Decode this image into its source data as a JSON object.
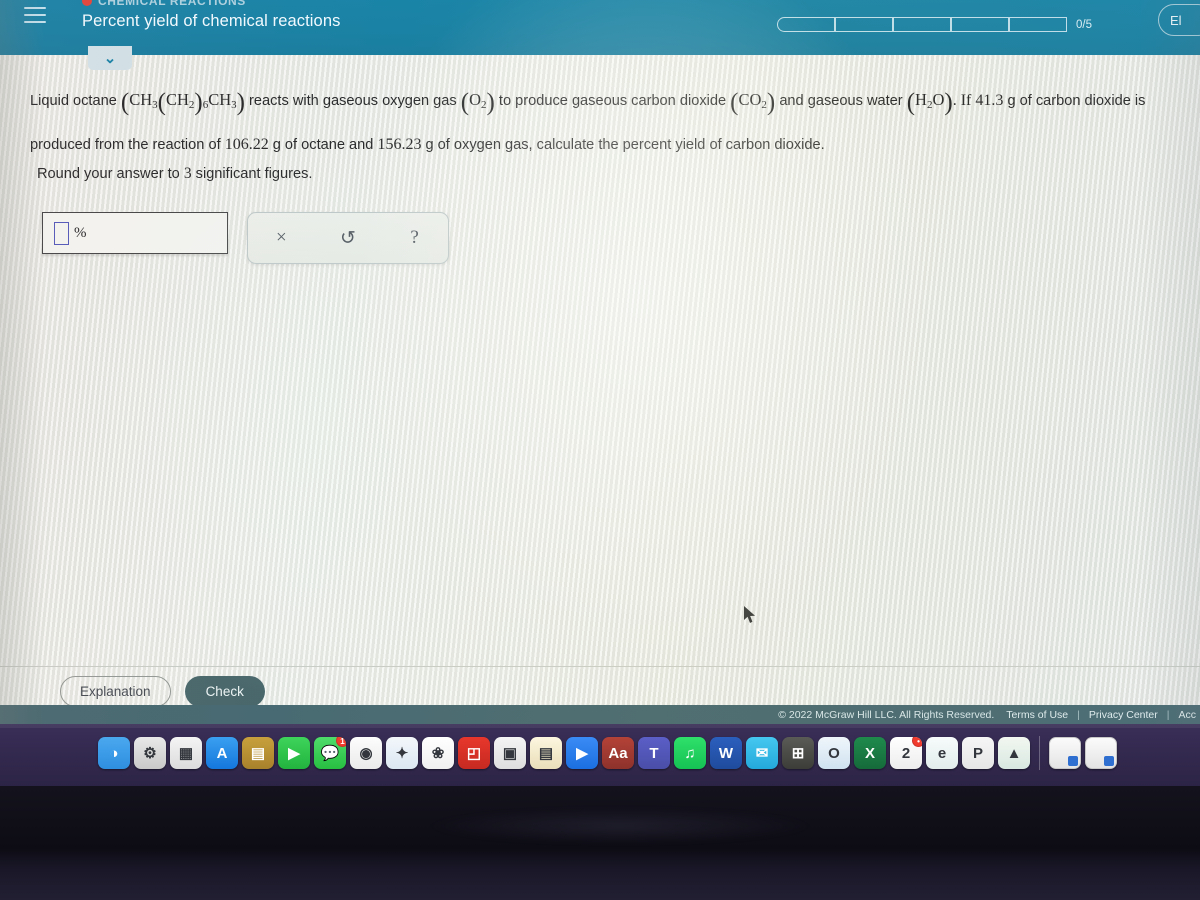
{
  "header": {
    "menu_icon": "hamburger-icon",
    "eyebrow": "CHEMICAL REACTIONS",
    "title": "Percent yield of chemical reactions",
    "progress_label": "0/5",
    "progress_segments": 5,
    "progress_filled": 0,
    "account_label": "El",
    "teal": "#0a7ba0"
  },
  "tab": {
    "chevron": "⌄"
  },
  "problem": {
    "p1": "Liquid octane",
    "f1_open": "(",
    "f1_a": "CH",
    "f1_a_sub": "3",
    "f1_b_open": "(",
    "f1_b": "CH",
    "f1_b_sub": "2",
    "f1_b_close": ")",
    "f1_b_n": "6",
    "f1_c": "CH",
    "f1_c_sub": "3",
    "f1_close": ")",
    "p2": "reacts with gaseous oxygen gas",
    "f2_open": "(",
    "f2_a": "O",
    "f2_a_sub": "2",
    "f2_close": ")",
    "p3": "to produce gaseous carbon dioxide",
    "f3_open": "(",
    "f3_a": "CO",
    "f3_a_sub": "2",
    "f3_close": ")",
    "p4": "and gaseous water",
    "f4_open": "(",
    "f4_a": "H",
    "f4_a_sub": "2",
    "f4_b": "O",
    "f4_close": ")",
    "p5": ". If",
    "mass_product": "41.3",
    "p6": "g of carbon dioxide is produced from the reaction of",
    "mass_octane": "106.22",
    "p7": "g of octane and",
    "mass_oxygen": "156.23",
    "p8": "g of oxygen gas, calculate the percent yield of carbon dioxide.",
    "round_pre": "Round your answer to",
    "round_sigfigs": "3",
    "round_post": "significant figures."
  },
  "answer": {
    "value": "",
    "placeholder": "",
    "unit": "%"
  },
  "mini_toolbar": {
    "clear": "×",
    "clear_name": "clear-icon",
    "undo": "↺",
    "undo_name": "undo-icon",
    "help": "?",
    "help_name": "help-icon"
  },
  "buttons": {
    "explanation": "Explanation",
    "check": "Check",
    "check_color": "#3e5d60"
  },
  "footer": {
    "copyright": "© 2022 McGraw Hill LLC. All Rights Reserved.",
    "links": [
      "Terms of Use",
      "Privacy Center",
      "Acc"
    ],
    "separator": "|"
  },
  "dock": {
    "items": [
      {
        "name": "finder",
        "glyph": "◑",
        "bg": "linear-gradient(180deg,#4aa8ef,#2f8fe0)",
        "running": true,
        "badge": ""
      },
      {
        "name": "system-preferences",
        "glyph": "⚙",
        "bg": "linear-gradient(180deg,#e9e9e9,#c9c9c9)",
        "running": false,
        "badge": ""
      },
      {
        "name": "launchpad",
        "glyph": "▦",
        "bg": "linear-gradient(180deg,#f4f4f4,#dcdcdc)",
        "running": false,
        "badge": ""
      },
      {
        "name": "app-store",
        "glyph": "A",
        "bg": "linear-gradient(180deg,#3aa0f0,#1477dd)",
        "running": false,
        "badge": ""
      },
      {
        "name": "notes",
        "glyph": "▤",
        "bg": "linear-gradient(180deg,#c8a03c,#a8812c)",
        "running": false,
        "badge": ""
      },
      {
        "name": "facetime",
        "glyph": "▶",
        "bg": "linear-gradient(180deg,#3ed45a,#22b33f)",
        "running": true,
        "badge": ""
      },
      {
        "name": "messages",
        "glyph": "💬",
        "bg": "linear-gradient(180deg,#4fdc6a,#27bf42)",
        "running": true,
        "badge": "1"
      },
      {
        "name": "chrome",
        "glyph": "◉",
        "bg": "linear-gradient(180deg,#fdfdfd,#eaeaea)",
        "running": false,
        "badge": ""
      },
      {
        "name": "safari",
        "glyph": "✦",
        "bg": "linear-gradient(180deg,#f3f7fb,#dbe7f2)",
        "running": false,
        "badge": ""
      },
      {
        "name": "photos",
        "glyph": "❀",
        "bg": "linear-gradient(180deg,#ffffff,#f0f0f0)",
        "running": false,
        "badge": ""
      },
      {
        "name": "keynote",
        "glyph": "◰",
        "bg": "linear-gradient(180deg,#e8372c,#c62a21)",
        "running": false,
        "badge": ""
      },
      {
        "name": "screenshot",
        "glyph": "▣",
        "bg": "linear-gradient(180deg,#f4f4f4,#dedede)",
        "running": false,
        "badge": ""
      },
      {
        "name": "calendar-app",
        "glyph": "▤",
        "bg": "linear-gradient(180deg,#fdf6df,#eadfba)",
        "running": true,
        "badge": ""
      },
      {
        "name": "zoom",
        "glyph": "▶",
        "bg": "linear-gradient(180deg,#3a8bf5,#1c6fe0)",
        "running": false,
        "badge": ""
      },
      {
        "name": "dictionary",
        "glyph": "Aa",
        "bg": "linear-gradient(180deg,#b44238,#8d322b)",
        "running": false,
        "badge": ""
      },
      {
        "name": "teams",
        "glyph": "T",
        "bg": "linear-gradient(180deg,#5b5fc7,#4a4ea8)",
        "running": false,
        "badge": ""
      },
      {
        "name": "spotify",
        "glyph": "♫",
        "bg": "linear-gradient(180deg,#2fe06a,#15c254)",
        "running": false,
        "badge": ""
      },
      {
        "name": "word",
        "glyph": "W",
        "bg": "linear-gradient(180deg,#2b5fbe,#1f4b9c)",
        "running": true,
        "badge": ""
      },
      {
        "name": "mail",
        "glyph": "✉",
        "bg": "linear-gradient(180deg,#45c8f0,#23a9db)",
        "running": false,
        "badge": ""
      },
      {
        "name": "calculator",
        "glyph": "⊞",
        "bg": "linear-gradient(180deg,#5a5a56,#3c3c38)",
        "running": false,
        "badge": ""
      },
      {
        "name": "outlook",
        "glyph": "O",
        "bg": "linear-gradient(180deg,#f0f6fb,#cfe2f0)",
        "running": true,
        "badge": ""
      },
      {
        "name": "excel",
        "glyph": "X",
        "bg": "linear-gradient(180deg,#1f8a4c,#156b3a)",
        "running": false,
        "badge": ""
      },
      {
        "name": "calendar",
        "glyph": "2",
        "bg": "linear-gradient(180deg,#ffffff,#ededed)",
        "running": false,
        "badge": "•"
      },
      {
        "name": "edge",
        "glyph": "e",
        "bg": "linear-gradient(180deg,#f7fbfb,#e2edec)",
        "running": true,
        "badge": ""
      },
      {
        "name": "powerpoint",
        "glyph": "P",
        "bg": "linear-gradient(180deg,#f6f6f6,#e6e6e6)",
        "running": true,
        "badge": ""
      },
      {
        "name": "maps",
        "glyph": "▲",
        "bg": "linear-gradient(180deg,#f2f7f0,#d9e8e2)",
        "running": true,
        "badge": ""
      }
    ],
    "trash_items": [
      {
        "name": "document-thumbnail-1"
      },
      {
        "name": "document-thumbnail-2"
      }
    ]
  }
}
